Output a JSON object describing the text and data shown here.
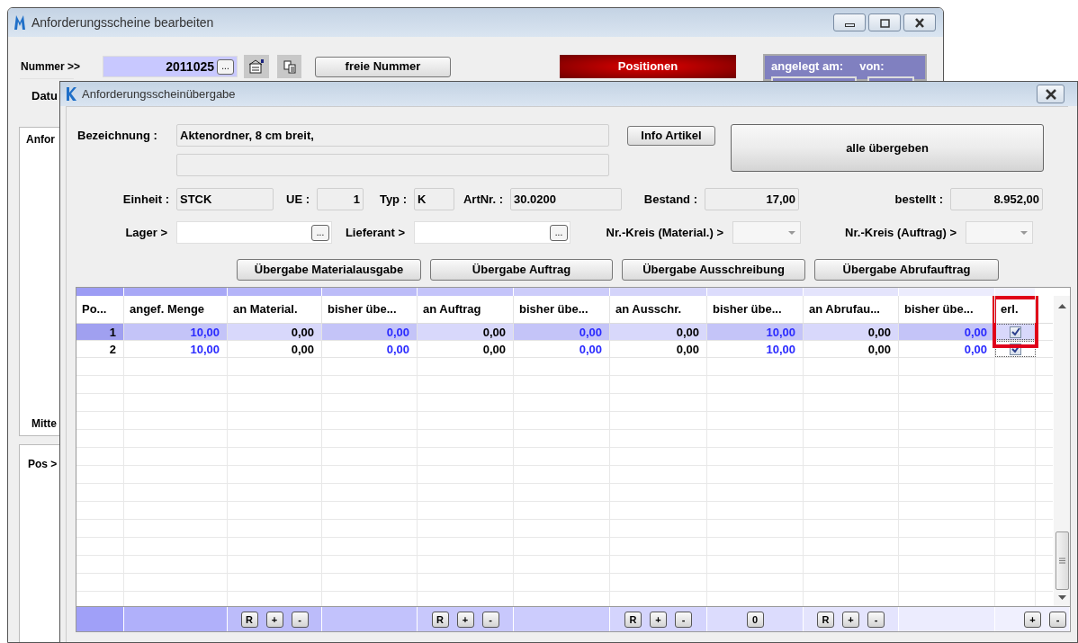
{
  "back_window": {
    "title": "Anforderungsscheine bearbeiten",
    "number_label": "Nummer >>",
    "number_value": "2011025",
    "browse_button": "...",
    "free_number_button": "freie Nummer",
    "positions_button": "Positionen",
    "created_on_label": "angelegt am:",
    "created_by_label": "von:",
    "date_label": "Datu",
    "group_label": "Anfor",
    "middle_label": "Mitte",
    "pos_label": "Pos >"
  },
  "dialog": {
    "title": "Anforderungsscheinübergabe",
    "description_label": "Bezeichnung :",
    "description_value": "Aktenordner, 8 cm breit,",
    "info_button": "Info  Artikel",
    "all_button": "alle übergeben",
    "info_fields": [
      {
        "label": "Einheit :",
        "value": "STCK"
      },
      {
        "label": "UE :",
        "value": "1"
      },
      {
        "label": "Typ :",
        "value": "K"
      },
      {
        "label": "ArtNr. :",
        "value": "30.0200"
      },
      {
        "label": "Bestand :",
        "value": "17,00"
      },
      {
        "label": "bestellt :",
        "value": "8.952,00"
      }
    ],
    "lookup_fields": [
      {
        "label": "Lager >",
        "kind": "browse",
        "button": "..."
      },
      {
        "label": "Lieferant >",
        "kind": "browse",
        "button": "..."
      },
      {
        "label": "Nr.-Kreis (Material.) >",
        "kind": "combo"
      },
      {
        "label": "Nr.-Kreis (Auftrag) >",
        "kind": "combo"
      }
    ],
    "transfer_buttons": [
      "Übergabe Materialausgabe",
      "Übergabe Auftrag",
      "Übergabe Ausschreibung",
      "Übergabe Abrufauftrag"
    ],
    "table": {
      "columns": [
        {
          "label": "Po...",
          "blue": false,
          "marked": false
        },
        {
          "label": "angef. Menge",
          "blue": true,
          "marked": false
        },
        {
          "label": "an Material.",
          "blue": false,
          "marked": false
        },
        {
          "label": "bisher übe...",
          "blue": true,
          "marked": false
        },
        {
          "label": "an Auftrag",
          "blue": false,
          "marked": false
        },
        {
          "label": "bisher übe...",
          "blue": true,
          "marked": false
        },
        {
          "label": "an Ausschr.",
          "blue": false,
          "marked": false
        },
        {
          "label": "bisher übe...",
          "blue": true,
          "marked": false
        },
        {
          "label": "an Abrufau...",
          "blue": false,
          "marked": false
        },
        {
          "label": "bisher übe...",
          "blue": true,
          "marked": false
        },
        {
          "label": "erl.",
          "marked": true
        }
      ],
      "rows": [
        {
          "selected": true,
          "done": true,
          "cells": [
            "1",
            "10,00",
            "0,00",
            "0,00",
            "0,00",
            "0,00",
            "0,00",
            "10,00",
            "0,00",
            "0,00"
          ]
        },
        {
          "selected": false,
          "done": true,
          "cells": [
            "2",
            "10,00",
            "0,00",
            "0,00",
            "0,00",
            "0,00",
            "0,00",
            "10,00",
            "0,00",
            "0,00"
          ]
        }
      ],
      "footer": [
        {
          "kind": "blank"
        },
        {
          "kind": "blank"
        },
        {
          "kind": "buttons",
          "buttons": [
            "R",
            "+",
            "-"
          ]
        },
        {
          "kind": "blank"
        },
        {
          "kind": "buttons",
          "buttons": [
            "R",
            "+",
            "-"
          ]
        },
        {
          "kind": "blank"
        },
        {
          "kind": "buttons",
          "buttons": [
            "R",
            "+",
            "-"
          ]
        },
        {
          "kind": "buttons",
          "buttons": [
            "0"
          ]
        },
        {
          "kind": "buttons",
          "buttons": [
            "R",
            "+",
            "-"
          ]
        },
        {
          "kind": "blank"
        },
        {
          "kind": "buttons",
          "buttons": [
            "+",
            "-"
          ]
        }
      ]
    }
  }
}
